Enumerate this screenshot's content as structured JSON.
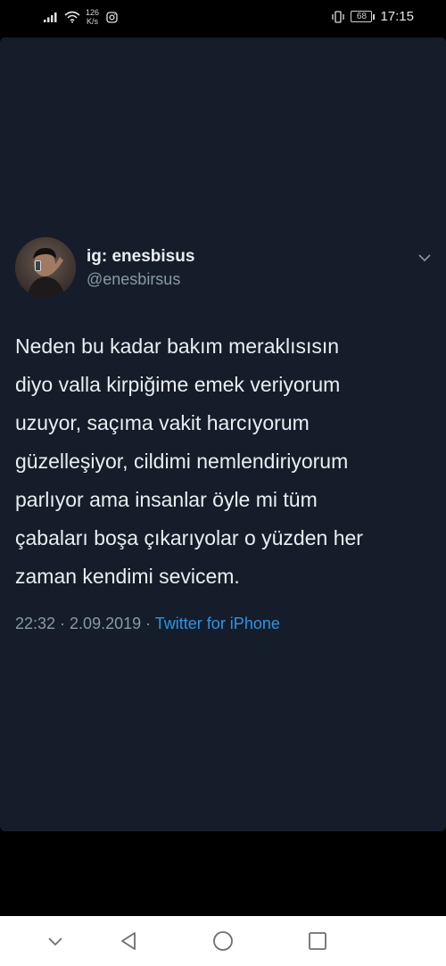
{
  "status_bar": {
    "speed_value": "126",
    "speed_unit": "K/s",
    "battery": "68",
    "time": "17:15",
    "icons": [
      "signal-icon",
      "wifi-icon",
      "instagram-icon",
      "vibrate-icon",
      "battery-icon"
    ]
  },
  "tweet": {
    "display_name": "ig: enesbisus",
    "handle": "@enesbirsus",
    "lines": [
      "Neden bu kadar bakım meraklısısın",
      "diyo valla kirpiğime emek veriyorum",
      "uzuyor, saçıma vakit harcıyorum",
      "güzelleşiyor, cildimi nemlendiriyorum",
      "parlıyor ama insanlar öyle mi tüm",
      "çabaları boşa çıkarıyolar o yüzden her",
      "zaman kendimi sevicem."
    ],
    "time": "22:32",
    "separator": " · ",
    "date": "2.09.2019",
    "source": "Twitter for iPhone"
  },
  "colors": {
    "card_bg": "#151d2a",
    "text_primary": "#e9eef3",
    "text_secondary": "#8899a6",
    "link": "#2c94e6"
  },
  "nav_bar": {
    "icons": [
      "chevron-down-icon",
      "back-icon",
      "home-icon",
      "recents-icon"
    ]
  }
}
